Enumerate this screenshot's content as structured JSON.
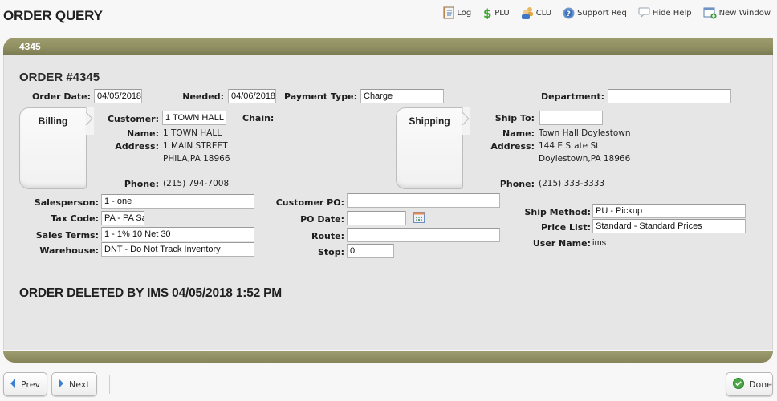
{
  "page": {
    "title": "ORDER QUERY"
  },
  "toolbar": {
    "items": [
      {
        "label": "Log",
        "icon": "log-icon"
      },
      {
        "label": "PLU",
        "icon": "dollar-icon"
      },
      {
        "label": "CLU",
        "icon": "users-icon"
      },
      {
        "label": "Support Req",
        "icon": "help-icon"
      },
      {
        "label": "Hide Help",
        "icon": "speech-bubble-icon"
      },
      {
        "label": "New Window",
        "icon": "new-window-icon"
      }
    ]
  },
  "panel": {
    "header_title": "4345"
  },
  "order": {
    "title": "ORDER #4345",
    "order_date_label": "Order Date:",
    "order_date": "04/05/2018",
    "needed_label": "Needed:",
    "needed": "04/06/2018",
    "payment_type_label": "Payment Type:",
    "payment_type": "Charge",
    "department_label": "Department:",
    "department": ""
  },
  "billing": {
    "tab_label": "Billing",
    "customer_label": "Customer:",
    "customer": "1 TOWN HALL",
    "chain_label": "Chain:",
    "name_label": "Name:",
    "name": "1 TOWN HALL",
    "address_label": "Address:",
    "address_line1": "1 MAIN STREET",
    "address_line2": "PHILA,PA 18966",
    "phone_label": "Phone:",
    "phone": "(215) 794-7008"
  },
  "shipping": {
    "tab_label": "Shipping",
    "ship_to_label": "Ship To:",
    "ship_to": "",
    "name_label": "Name:",
    "name": "Town Hall Doylestown",
    "address_label": "Address:",
    "address_line1": "144 E State St",
    "address_line2": "Doylestown,PA 18966",
    "phone_label": "Phone:",
    "phone": "(215) 333-3333"
  },
  "details": {
    "salesperson_label": "Salesperson:",
    "salesperson": "1 - one",
    "tax_code_label": "Tax Code:",
    "tax_code": "PA - PA Sa",
    "sales_terms_label": "Sales Terms:",
    "sales_terms": "1 - 1% 10 Net 30",
    "warehouse_label": "Warehouse:",
    "warehouse": "DNT - Do Not Track Inventory",
    "customer_po_label": "Customer PO:",
    "customer_po": "",
    "po_date_label": "PO Date:",
    "po_date": "",
    "route_label": "Route:",
    "route": "",
    "stop_label": "Stop:",
    "stop": "0",
    "ship_method_label": "Ship Method:",
    "ship_method": "PU - Pickup",
    "price_list_label": "Price List:",
    "price_list": "Standard - Standard Prices",
    "user_name_label": "User Name:",
    "user_name": "ims"
  },
  "status": {
    "deleted_message": "ORDER DELETED BY IMS 04/05/2018 1:52 PM"
  },
  "footer": {
    "prev_label": "Prev",
    "next_label": "Next",
    "done_label": "Done"
  }
}
